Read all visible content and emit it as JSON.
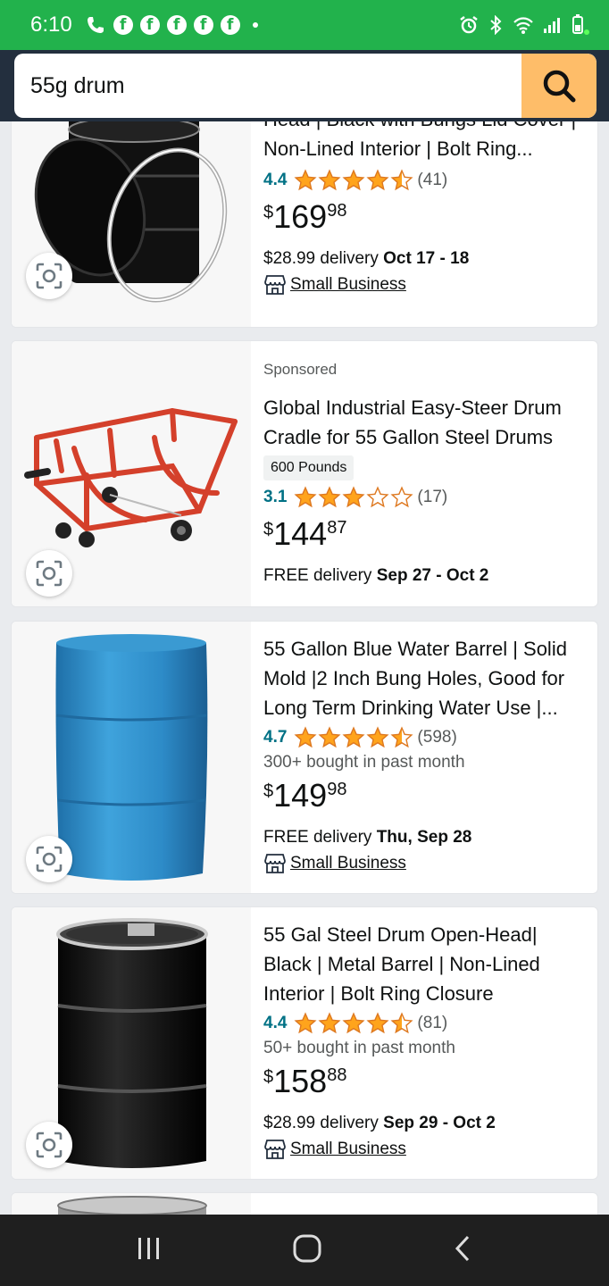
{
  "status_bar": {
    "time": "6:10"
  },
  "search": {
    "value": "55g drum"
  },
  "products": [
    {
      "sponsored": "",
      "title": "Head | Black with Bungs Lid Cover | Non-Lined Interior | Bolt Ring...",
      "badge": "",
      "rating": "4.4",
      "stars": 4.4,
      "count": "(41)",
      "bought": "",
      "price_symbol": "$",
      "price_whole": "169",
      "price_fraction": "98",
      "delivery_prefix": "$28.99 delivery",
      "delivery_date": "Oct 17 - 18",
      "small_business": "Small Business"
    },
    {
      "sponsored": "Sponsored",
      "title": "Global Industrial Easy-Steer Drum Cradle for 55 Gallon Steel Drums",
      "badge": "600 Pounds",
      "rating": "3.1",
      "stars": 3.1,
      "count": "(17)",
      "bought": "",
      "price_symbol": "$",
      "price_whole": "144",
      "price_fraction": "87",
      "delivery_prefix": "FREE delivery",
      "delivery_date": "Sep 27 - Oct 2",
      "small_business": ""
    },
    {
      "sponsored": "",
      "title": "55 Gallon Blue Water Barrel | Solid Mold |2 Inch Bung Holes, Good for Long Term Drinking Water Use |...",
      "badge": "",
      "rating": "4.7",
      "stars": 4.7,
      "count": "(598)",
      "bought": "300+ bought in past month",
      "price_symbol": "$",
      "price_whole": "149",
      "price_fraction": "98",
      "delivery_prefix": "FREE delivery",
      "delivery_date": "Thu, Sep 28",
      "small_business": "Small Business"
    },
    {
      "sponsored": "",
      "title": "55 Gal Steel Drum Open-Head| Black | Metal Barrel | Non-Lined Interior | Bolt Ring Closure",
      "badge": "",
      "rating": "4.4",
      "stars": 4.4,
      "count": "(81)",
      "bought": "50+ bought in past month",
      "price_symbol": "$",
      "price_whole": "158",
      "price_fraction": "88",
      "delivery_prefix": "$28.99 delivery",
      "delivery_date": "Sep 29 - Oct 2",
      "small_business": "Small Business"
    }
  ],
  "colors": {
    "status_bar": "#22b24c",
    "header": "#232f3e",
    "search_button": "#febd69",
    "star": "#ffa41c",
    "link": "#007185"
  },
  "icons": [
    "search-icon",
    "camera-lens-icon",
    "star-icon",
    "store-icon",
    "recent-apps-icon",
    "home-icon",
    "back-icon"
  ]
}
